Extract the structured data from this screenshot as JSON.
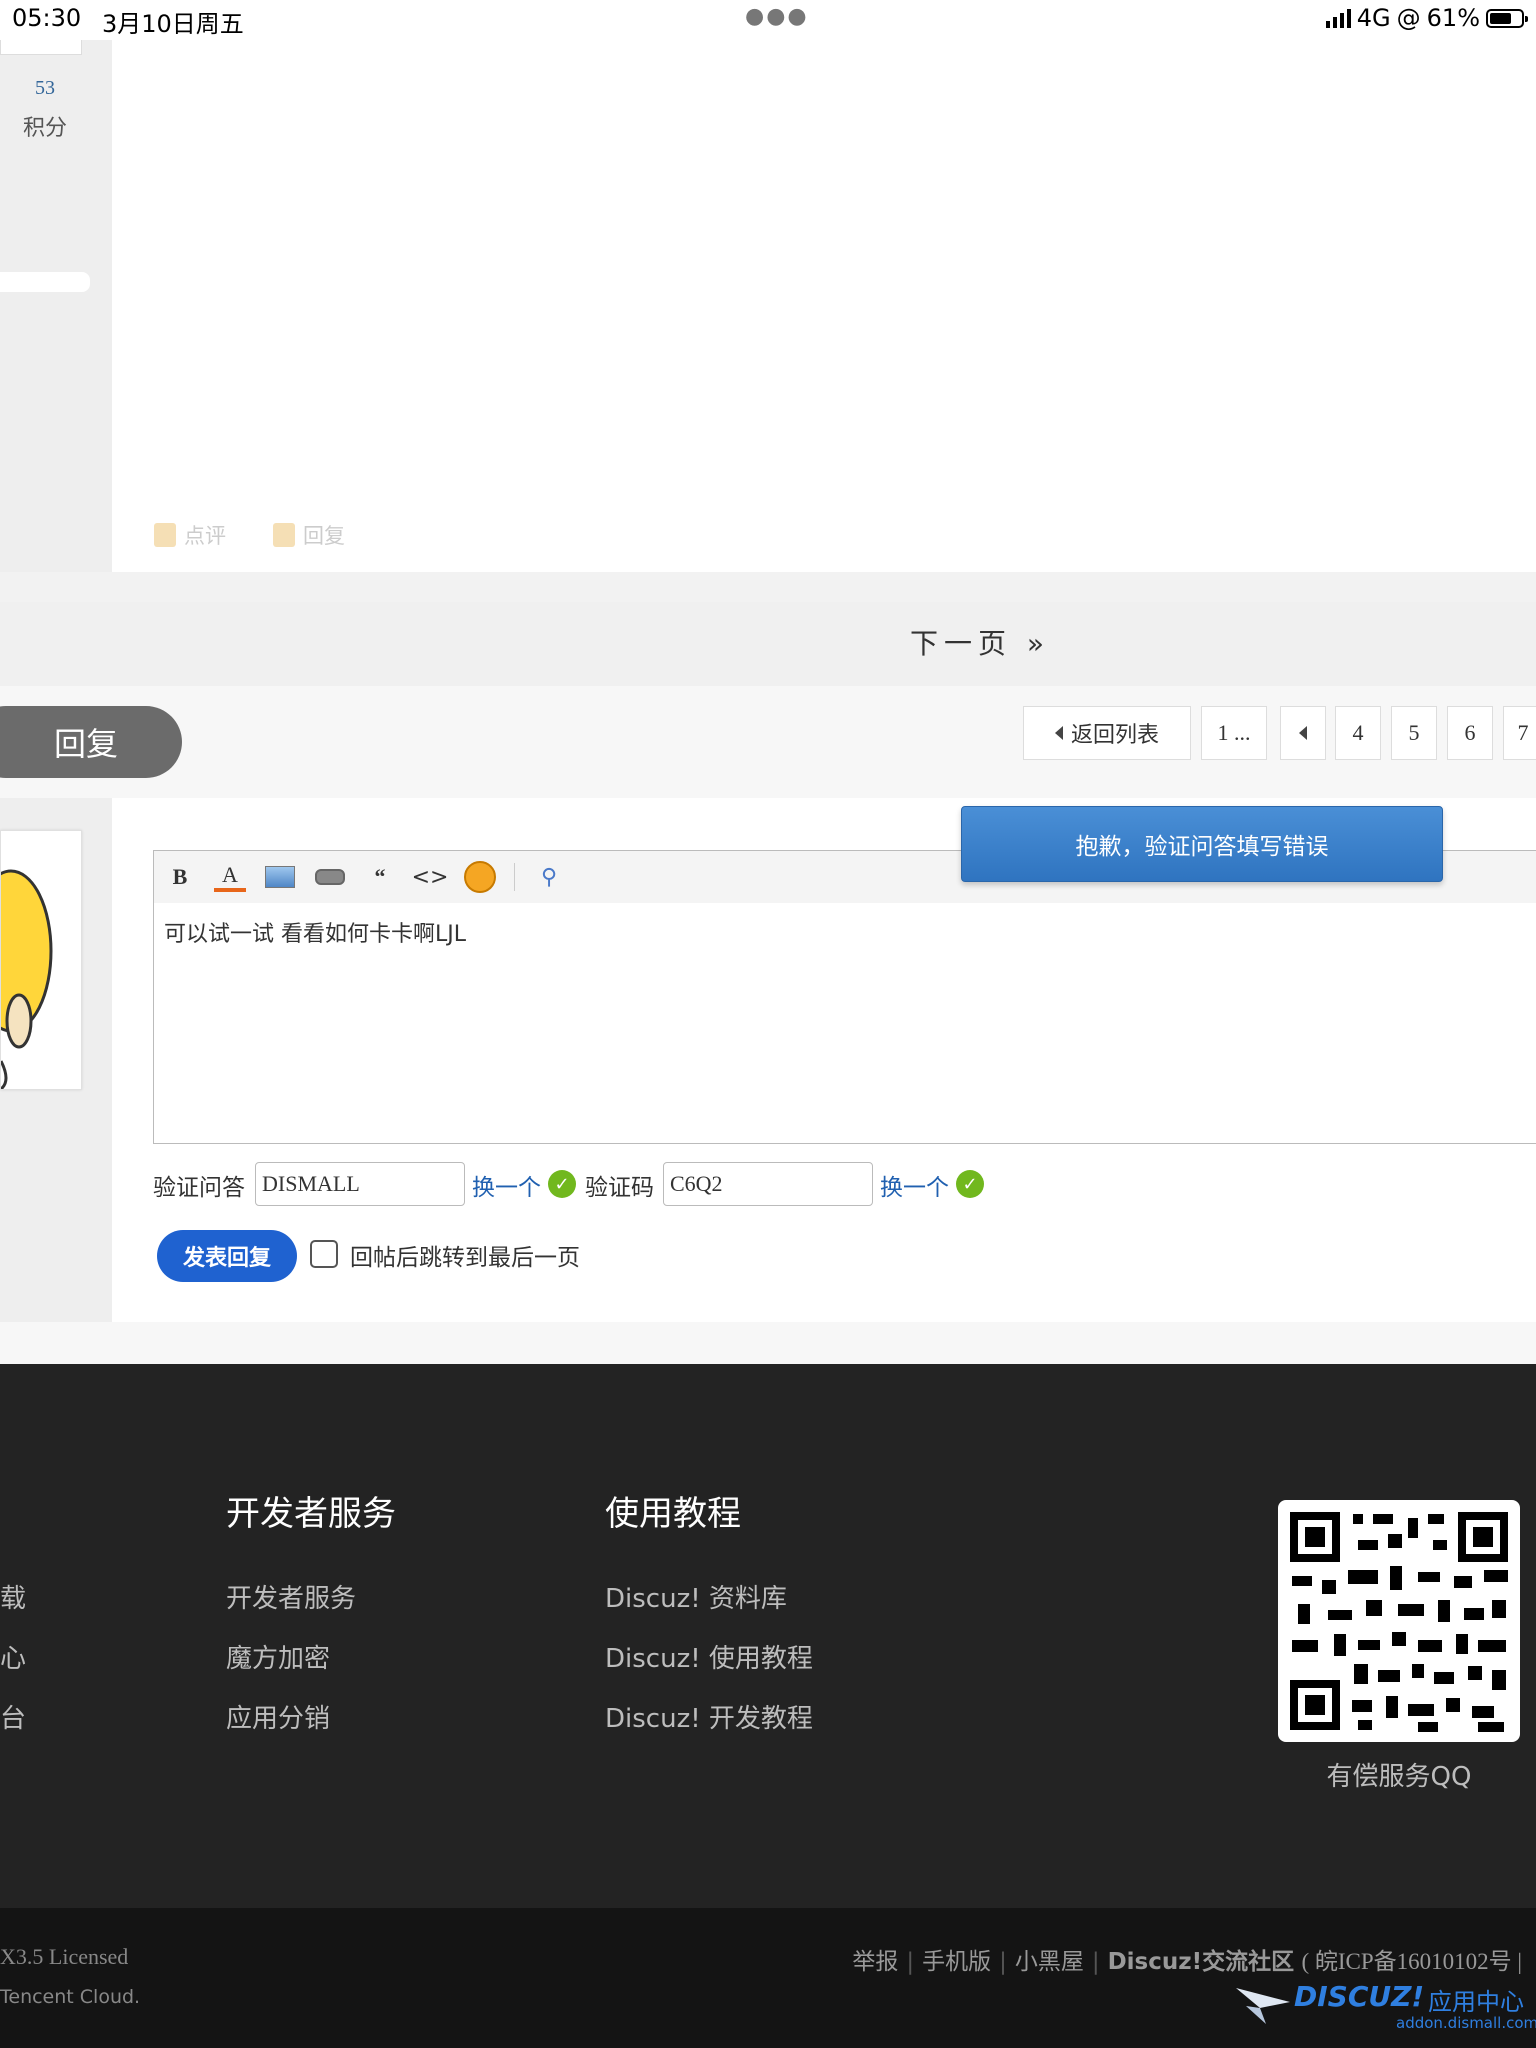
{
  "status_bar": {
    "time": "05:30",
    "date": "3月10日周五",
    "network": "4G",
    "battery": "61%"
  },
  "profile": {
    "credits_value": "53",
    "credits_label": "积分"
  },
  "post_actions": {
    "comment": "点评",
    "reply": "回复"
  },
  "next_page": "下一页 »",
  "reply_button": "回复",
  "pagination": {
    "back_to_list": "返回列表",
    "first": "1 ...",
    "pages": [
      "4",
      "5",
      "6",
      "7"
    ]
  },
  "error_tip": "抱歉，验证问答填写错误",
  "editor": {
    "content": "可以试一试 看看如何卡卡啊LJL",
    "toolbar": [
      "bold-icon",
      "font-color-icon",
      "image-icon",
      "attachment-icon",
      "quote-icon",
      "code-icon",
      "smiley-icon",
      "link-icon"
    ]
  },
  "verification": {
    "question_label": "验证问答",
    "question_value": "DISMALL",
    "swap_label": "换一个",
    "code_label": "验证码",
    "code_value": "C6Q2",
    "swap_label_2": "换一个"
  },
  "submit": {
    "button": "发表回复",
    "jump_label": "回帖后跳转到最后一页"
  },
  "footer": {
    "left_fragments": [
      "载",
      "心",
      "台"
    ],
    "col1": {
      "title": "开发者服务",
      "links": [
        "开发者服务",
        "魔方加密",
        "应用分销"
      ]
    },
    "col2": {
      "title": "使用教程",
      "links": [
        "Discuz! 资料库",
        "Discuz! 使用教程",
        "Discuz! 开发教程"
      ]
    },
    "qr_label": "有偿服务QQ",
    "licensed": "X3.5 Licensed",
    "cloud": "Tencent Cloud.",
    "bottom_links": [
      "举报",
      "手机版",
      "小黑屋",
      "Discuz!交流社区",
      "( 皖ICP备16010102号 |"
    ],
    "logo_text": "DISCUZ!",
    "logo_suffix": "应用中心",
    "logo_domain": "addon.dismall.com"
  }
}
